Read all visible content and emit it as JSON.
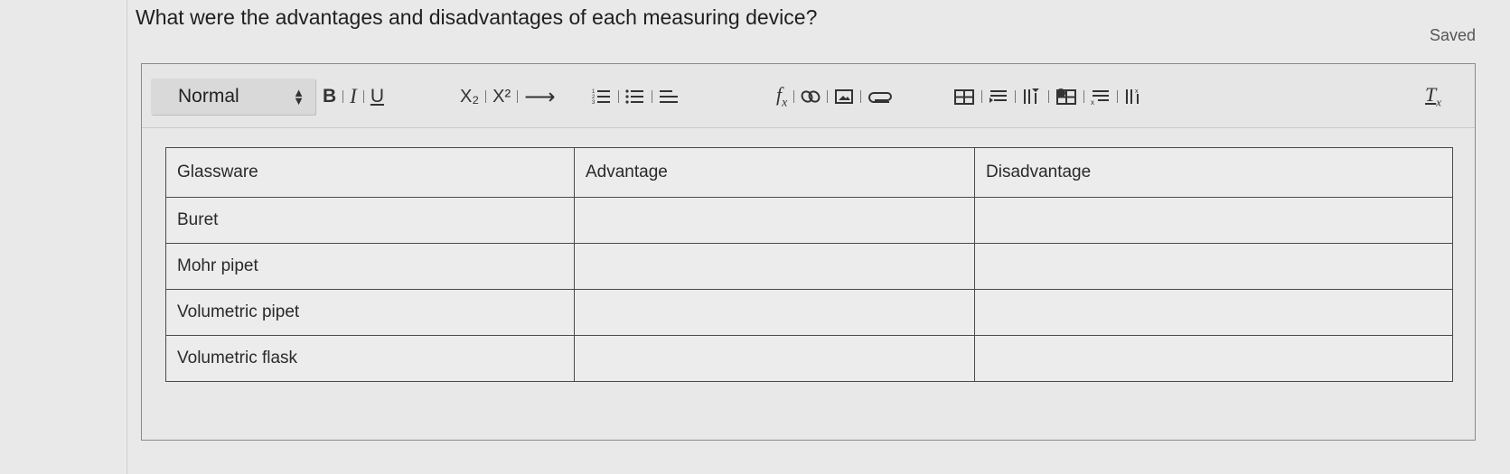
{
  "question": {
    "text": "What were the advantages and disadvantages of each measuring device?"
  },
  "status": {
    "saved_label": "Saved"
  },
  "toolbar": {
    "format_select": {
      "selected": "Normal"
    },
    "buttons": [
      {
        "name": "bold-button",
        "icon": "bold-icon",
        "glyph": "B"
      },
      {
        "name": "italic-button",
        "icon": "italic-icon",
        "glyph": "I"
      },
      {
        "name": "underline-button",
        "icon": "underline-icon",
        "glyph": "U"
      },
      {
        "name": "subscript-button",
        "icon": "subscript-icon",
        "glyph": "X₂"
      },
      {
        "name": "superscript-button",
        "icon": "superscript-icon",
        "glyph": "X²"
      },
      {
        "name": "arrow-button",
        "icon": "right-arrow-icon",
        "glyph": "⟶"
      },
      {
        "name": "ordered-list-button",
        "icon": "ordered-list-icon"
      },
      {
        "name": "bullet-list-button",
        "icon": "bullet-list-icon"
      },
      {
        "name": "align-button",
        "icon": "align-icon"
      },
      {
        "name": "formula-button",
        "icon": "formula-icon",
        "glyph": "fx"
      },
      {
        "name": "link-button",
        "icon": "link-icon"
      },
      {
        "name": "image-button",
        "icon": "image-icon"
      },
      {
        "name": "attachment-button",
        "icon": "paperclip-icon"
      },
      {
        "name": "insert-table-button",
        "icon": "table-icon"
      },
      {
        "name": "insert-row-button",
        "icon": "insert-row-icon"
      },
      {
        "name": "insert-column-button",
        "icon": "insert-column-icon"
      },
      {
        "name": "delete-table-button",
        "icon": "delete-table-icon"
      },
      {
        "name": "delete-row-button",
        "icon": "delete-row-icon"
      },
      {
        "name": "delete-column-button",
        "icon": "delete-column-icon"
      },
      {
        "name": "clear-format-button",
        "icon": "clear-format-icon",
        "glyph": "Tx"
      }
    ]
  },
  "table": {
    "headers": [
      "Glassware",
      "Advantage",
      "Disadvantage"
    ],
    "rows": [
      [
        "Buret",
        "",
        ""
      ],
      [
        "Mohr pipet",
        "",
        ""
      ],
      [
        "Volumetric pipet",
        "",
        ""
      ],
      [
        "Volumetric flask",
        "",
        ""
      ]
    ]
  }
}
